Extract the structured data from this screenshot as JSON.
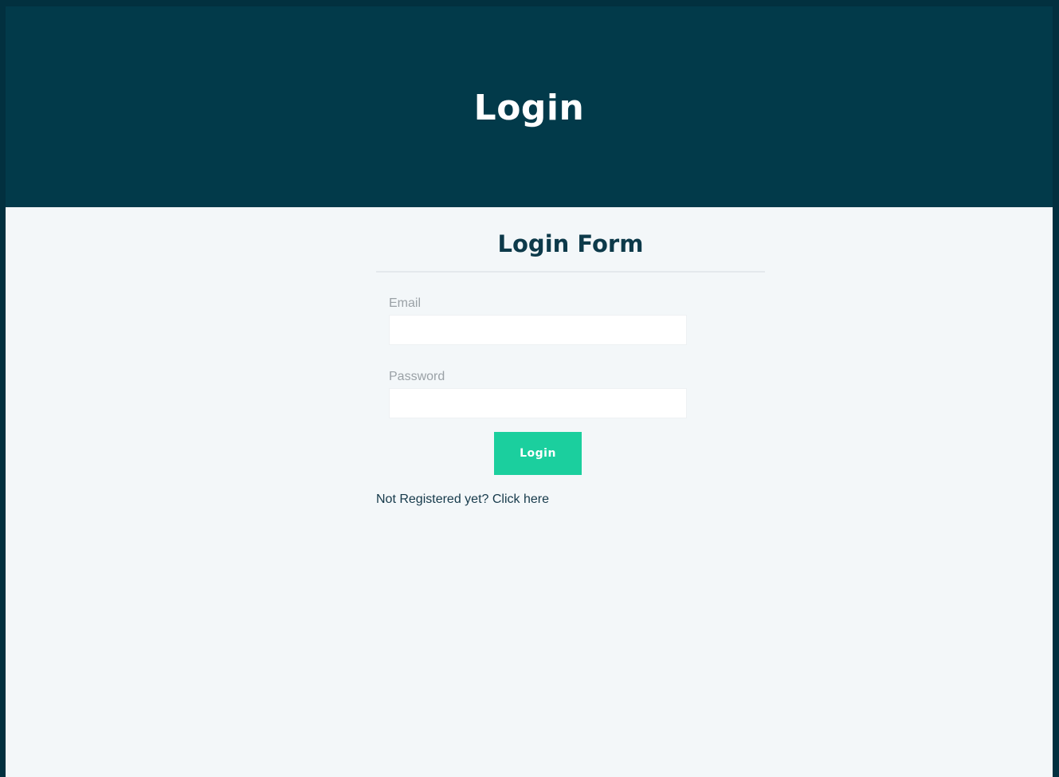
{
  "header": {
    "title": "Login"
  },
  "form": {
    "title": "Login Form",
    "email_label": "Email",
    "email_value": "",
    "password_label": "Password",
    "password_value": "",
    "submit_label": "Login",
    "register_prompt": "Not Registered yet?",
    "register_link": "Click here"
  },
  "colors": {
    "header_bg": "#023a4a",
    "page_bg": "#f3f7f9",
    "accent": "#1bcf9e",
    "heading_text": "#0d3a4a"
  }
}
